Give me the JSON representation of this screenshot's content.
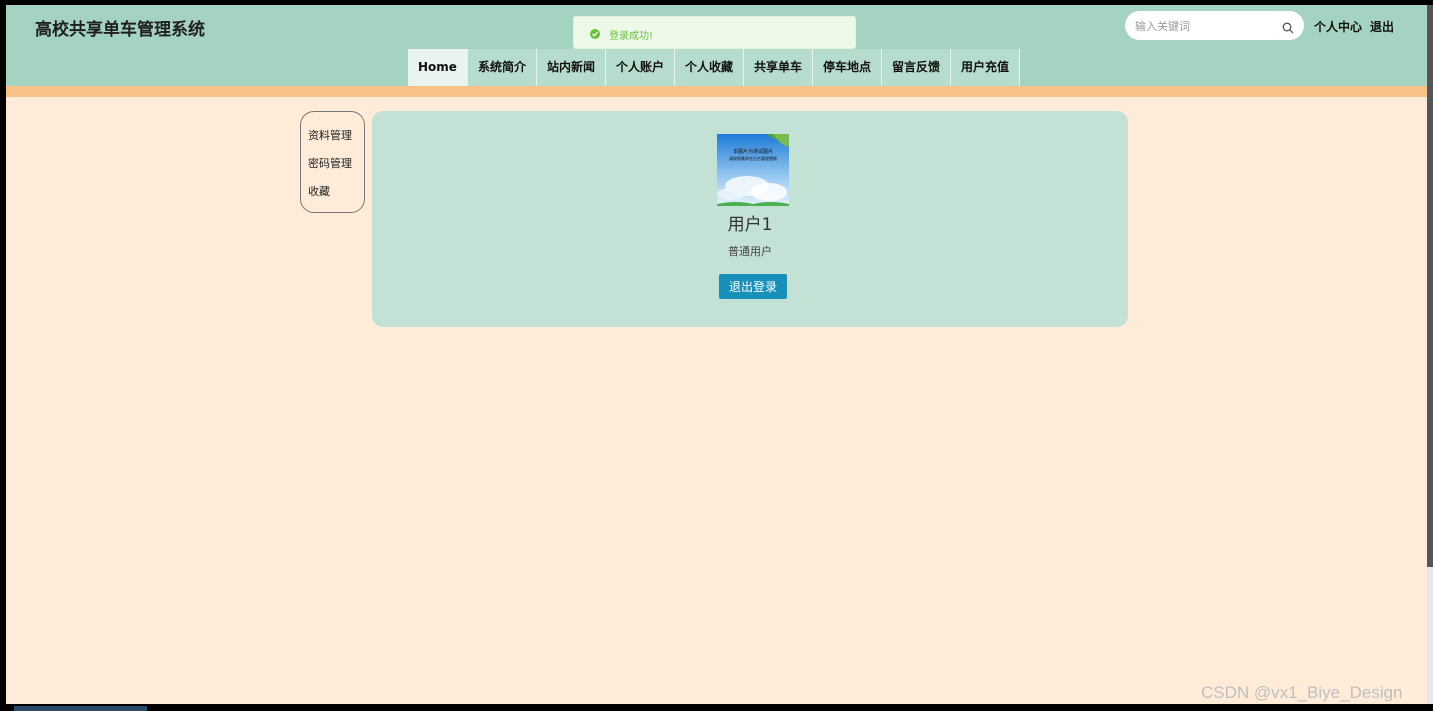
{
  "header": {
    "site_title": "高校共享单车管理系统",
    "search_placeholder": "输入关键词",
    "user_center": "个人中心",
    "logout": "退出"
  },
  "toast": {
    "message": "登录成功!",
    "icon": "check-circle-icon"
  },
  "nav": {
    "items": [
      {
        "label": "Home"
      },
      {
        "label": "系统简介"
      },
      {
        "label": "站内新闻"
      },
      {
        "label": "个人账户"
      },
      {
        "label": "个人收藏"
      },
      {
        "label": "共享单车"
      },
      {
        "label": "停车地点"
      },
      {
        "label": "留言反馈"
      },
      {
        "label": "用户充值"
      }
    ],
    "active": "Home"
  },
  "sidebar": {
    "items": [
      {
        "label": "资料管理"
      },
      {
        "label": "密码管理"
      },
      {
        "label": "收藏"
      }
    ]
  },
  "profile": {
    "avatar_caption_line1": "本图片为测试图片",
    "avatar_caption_line2": "请按照需求在后台管理替换",
    "username": "用户1",
    "role": "普通用户",
    "logout_button": "退出登录"
  },
  "watermark": "CSDN @vx1_Biye_Design",
  "colors": {
    "header_bg": "#a5d3c1",
    "accent_bar": "#f9c287",
    "page_bg": "#feecd9",
    "card_bg": "#c4e1d6",
    "button_bg": "#1790b9",
    "success": "#67c23a"
  }
}
